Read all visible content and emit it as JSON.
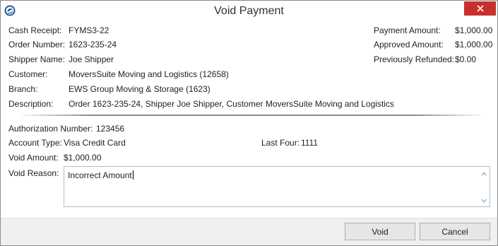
{
  "window": {
    "title": "Void Payment"
  },
  "receipt": {
    "cash_receipt_label": "Cash Receipt:",
    "cash_receipt_value": "FYMS3-22",
    "order_number_label": "Order Number:",
    "order_number_value": "1623-235-24",
    "shipper_name_label": "Shipper Name:",
    "shipper_name_value": "Joe Shipper",
    "customer_label": "Customer:",
    "customer_value": "MoversSuite Moving and Logistics (12658)",
    "branch_label": "Branch:",
    "branch_value": "EWS Group Moving & Storage (1623)",
    "description_label": "Description:",
    "description_value": "Order 1623-235-24, Shipper Joe Shipper, Customer MoversSuite Moving and Logistics"
  },
  "amounts": {
    "payment_amount_label": "Payment Amount:",
    "payment_amount_value": "$1,000.00",
    "approved_amount_label": "Approved Amount:",
    "approved_amount_value": "$1,000.00",
    "previously_refunded_label": "Previously Refunded:",
    "previously_refunded_value": "$0.00"
  },
  "authorization": {
    "auth_number_label": "Authorization Number:",
    "auth_number_value": "123456",
    "account_type_label": "Account Type:",
    "account_type_value": "Visa Credit Card",
    "last_four_label": "Last Four:",
    "last_four_value": "1111",
    "void_amount_label": "Void Amount:",
    "void_amount_value": "$1,000.00",
    "void_reason_label": "Void Reason:",
    "void_reason_value": "Incorrect Amount"
  },
  "buttons": {
    "void_label": "Void",
    "cancel_label": "Cancel"
  },
  "colors": {
    "close_button": "#c9302c",
    "footer_bg": "#f0f0f0",
    "input_border": "#a9c0d6"
  }
}
